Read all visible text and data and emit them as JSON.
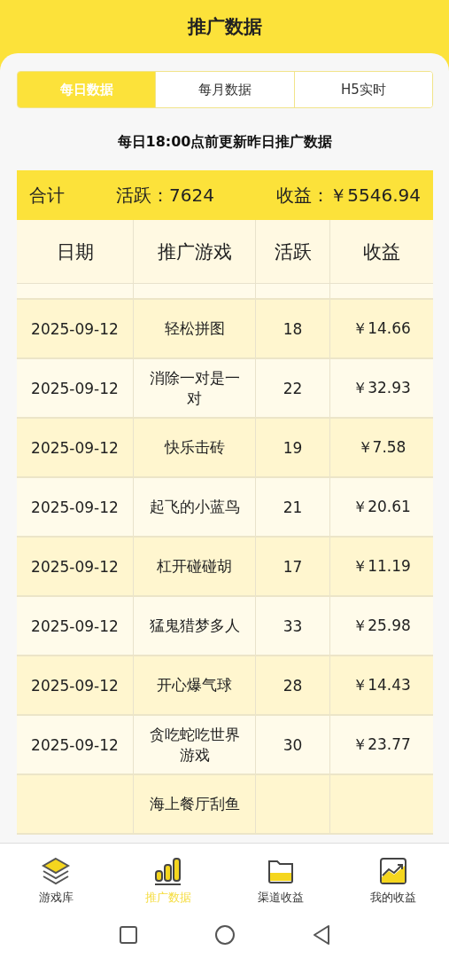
{
  "header": {
    "title": "推广数据"
  },
  "tabs": [
    {
      "label": "每日数据",
      "selected": true
    },
    {
      "label": "每月数据",
      "selected": false
    },
    {
      "label": "H5实时",
      "selected": false
    }
  ],
  "notice": "每日18:00点前更新昨日推广数据",
  "summary": {
    "label": "合计",
    "active": "活跃：7624",
    "income": "收益：￥5546.94"
  },
  "table": {
    "columns": [
      "日期",
      "推广游戏",
      "活跃",
      "收益"
    ],
    "rows": [
      [
        "2025-09-12",
        "轻松拼图",
        "18",
        "￥14.66"
      ],
      [
        "2025-09-12",
        "消除一对是一对",
        "22",
        "￥32.93"
      ],
      [
        "2025-09-12",
        "快乐击砖",
        "19",
        "￥7.58"
      ],
      [
        "2025-09-12",
        "起飞的小蓝鸟",
        "21",
        "￥20.61"
      ],
      [
        "2025-09-12",
        "杠开碰碰胡",
        "17",
        "￥11.19"
      ],
      [
        "2025-09-12",
        "猛鬼猎梦多人",
        "33",
        "￥25.98"
      ],
      [
        "2025-09-12",
        "开心爆气球",
        "28",
        "￥14.43"
      ],
      [
        "2025-09-12",
        "贪吃蛇吃世界游戏",
        "30",
        "￥23.77"
      ],
      [
        "",
        "海上餐厅刮鱼",
        "",
        ""
      ]
    ]
  },
  "bottom_nav": [
    {
      "label": "游戏库",
      "kind": "layers",
      "selected": false
    },
    {
      "label": "推广数据",
      "kind": "bars",
      "selected": true
    },
    {
      "label": "渠道收益",
      "kind": "folder",
      "selected": false
    },
    {
      "label": "我的收益",
      "kind": "chart",
      "selected": false
    }
  ]
}
